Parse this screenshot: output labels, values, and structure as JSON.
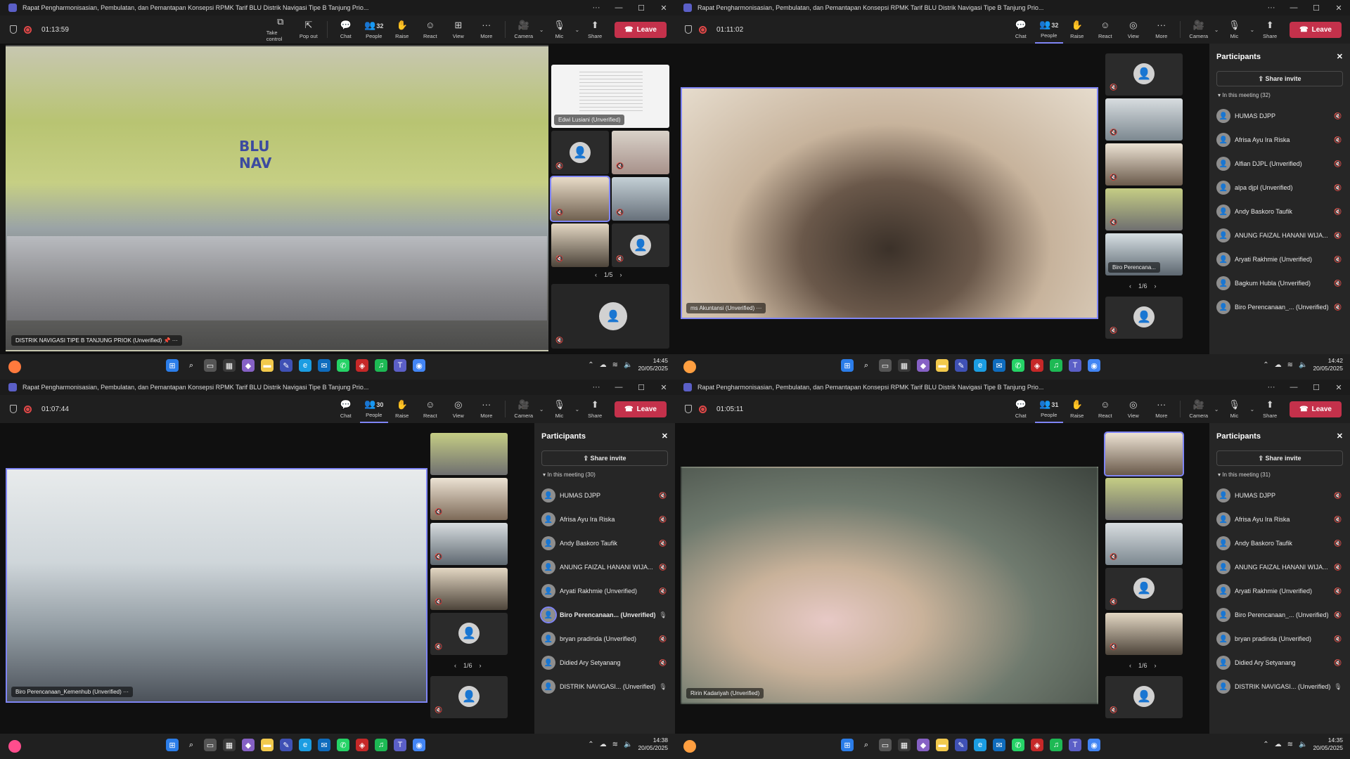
{
  "window_title": "Rapat Pengharmonisasian, Pembulatan, dan Pemantapan Konsepsi RPMK Tarif BLU Distrik Navigasi Tipe B Tanjung Prio...",
  "toolbar_labels": {
    "take_control": "Take control",
    "pop_out": "Pop out",
    "chat": "Chat",
    "people": "People",
    "raise": "Raise",
    "react": "React",
    "view": "View",
    "more": "More",
    "camera": "Camera",
    "mic": "Mic",
    "share": "Share",
    "leave": "Leave"
  },
  "participants_panel": {
    "title": "Participants",
    "share_invite": "Share invite"
  },
  "quadrants": [
    {
      "timer": "01:13:59",
      "people_count": "32",
      "main_name": "DISTRIK NAVIGASI TIPE B TANJUNG PRIOK (Unverified)",
      "pinned_name": "Edwi Lusiani (Unverified)",
      "pager": "1/5",
      "logo_text": "BLU NAV",
      "time": "14:45",
      "date": "20/05/2025"
    },
    {
      "timer": "01:11:02",
      "people_count": "32",
      "main_name": "ms Akuntansi (Unverified)",
      "side_name": "Biro Perencana...",
      "pager": "1/6",
      "section": "In this meeting (32)",
      "participants": [
        "HUMAS DJPP",
        "Afrisa Ayu Ira Riska",
        "Alfian DJPL (Unverified)",
        "alpa djpl (Unverified)",
        "Andy Baskoro Taufik",
        "ANUNG FAIZAL HANANI WIJA...",
        "Aryati Rakhmie (Unverified)",
        "Bagkum Hubla (Unverified)",
        "Biro Perencanaan_... (Unverified)"
      ],
      "time": "14:42",
      "date": "20/05/2025"
    },
    {
      "timer": "01:07:44",
      "people_count": "30",
      "main_name": "Biro Perencanaan_Kemenhub (Unverified)",
      "pager": "1/6",
      "section": "In this meeting (30)",
      "participants": [
        "HUMAS DJPP",
        "Afrisa Ayu Ira Riska",
        "Andy Baskoro Taufik",
        "ANUNG FAIZAL HANANI WIJA...",
        "Aryati Rakhmie (Unverified)",
        "Biro Perencanaan... (Unverified)",
        "bryan pradinda (Unverified)",
        "Didied Ary Setyanang",
        "DISTRIK NAVIGASI... (Unverified)"
      ],
      "time": "14:38",
      "date": "20/05/2025"
    },
    {
      "timer": "01:05:11",
      "people_count": "31",
      "main_name": "Ririn Kadariyah (Unverified)",
      "pager": "1/6",
      "section": "In this meeting (31)",
      "participants": [
        "HUMAS DJPP",
        "Afrisa Ayu Ira Riska",
        "Andy Baskoro Taufik",
        "ANUNG FAIZAL HANANI WIJA...",
        "Aryati Rakhmie (Unverified)",
        "Biro Perencanaan_... (Unverified)",
        "bryan pradinda (Unverified)",
        "Didied Ary Setyanang",
        "DISTRIK NAVIGASI... (Unverified)"
      ],
      "time": "14:35",
      "date": "20/05/2025"
    }
  ],
  "colors": {
    "accent": "#7f85f5",
    "leave": "#c4314b",
    "stage_accent": "#27b6b0"
  }
}
